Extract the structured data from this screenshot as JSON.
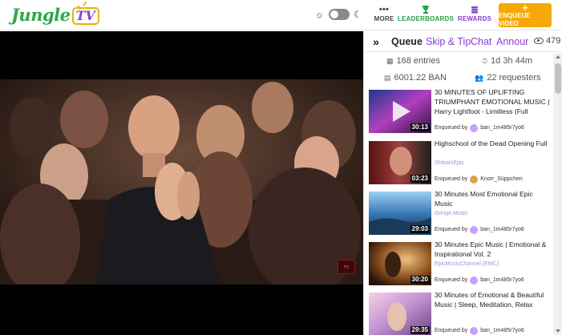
{
  "header": {
    "logo_text": "Jungle",
    "logo_tv": "TV",
    "icons": {
      "theme_light": "sun-icon",
      "theme_dark": "moon-icon",
      "more": "ellipsis-icon",
      "leaderboards": "trophy-icon",
      "rewards": "coins-icon",
      "enqueue": "plus-icon"
    },
    "more_label": "MORE",
    "leaderboards_label": "LEADERBOARDS",
    "rewards_label": "REWARDS",
    "enqueue_label": "ENQUEUE VIDEO",
    "colors": {
      "brand_green": "#2ea84a",
      "brand_purple": "#8c3fd1",
      "enqueue_orange": "#f6a905"
    }
  },
  "player": {
    "overlay_badge": "TV"
  },
  "sidebar": {
    "collapse_icon": "chevron-double-right-icon",
    "tabs": [
      {
        "label": "Queue",
        "active": true
      },
      {
        "label": "Skip & Tip",
        "active": false
      },
      {
        "label": "Chat",
        "active": false
      },
      {
        "label": "Announ",
        "active": false
      }
    ],
    "viewer_count": "479",
    "stats": {
      "entries": "168 entries",
      "remaining_time": "1d 3h 44m",
      "ban_total": "6001.22 BAN",
      "requesters": "22 requesters"
    },
    "queue": [
      {
        "title": "30 MINUTES OF UPLIFTING TRIUMPHANT EMOTIONAL MUSIC | Harry Lightfoot - Limitless (Full",
        "channel": "",
        "duration": "30:13",
        "enqueued_label": "Enqueued by",
        "requester": "ban_1m485r7yo6"
      },
      {
        "title": "Highschool of the Dead Opening Full",
        "channel": "ShibaIsEpic",
        "duration": "03:23",
        "enqueued_label": "Enqueued by",
        "requester": "Knorr_Süppchen"
      },
      {
        "title": "30 Minutes Most Emotional Epic Music",
        "channel": "Gringo Music",
        "duration": "29:03",
        "enqueued_label": "Enqueued by",
        "requester": "ban_1m485r7yo6"
      },
      {
        "title": "30 Minutes Epic Music | Emotional & Inspirational Vol. 2",
        "channel": "EpicMusicChannel (EMC)",
        "duration": "30:20",
        "enqueued_label": "Enqueued by",
        "requester": "ban_1m485r7yo6"
      },
      {
        "title": "30 Minutes of Emotional & Beautiful Music | Sleep, Meditation, Relax",
        "channel": "",
        "duration": "29:35",
        "enqueued_label": "Enqueued by",
        "requester": "ban_1m485r7yo6"
      }
    ]
  }
}
